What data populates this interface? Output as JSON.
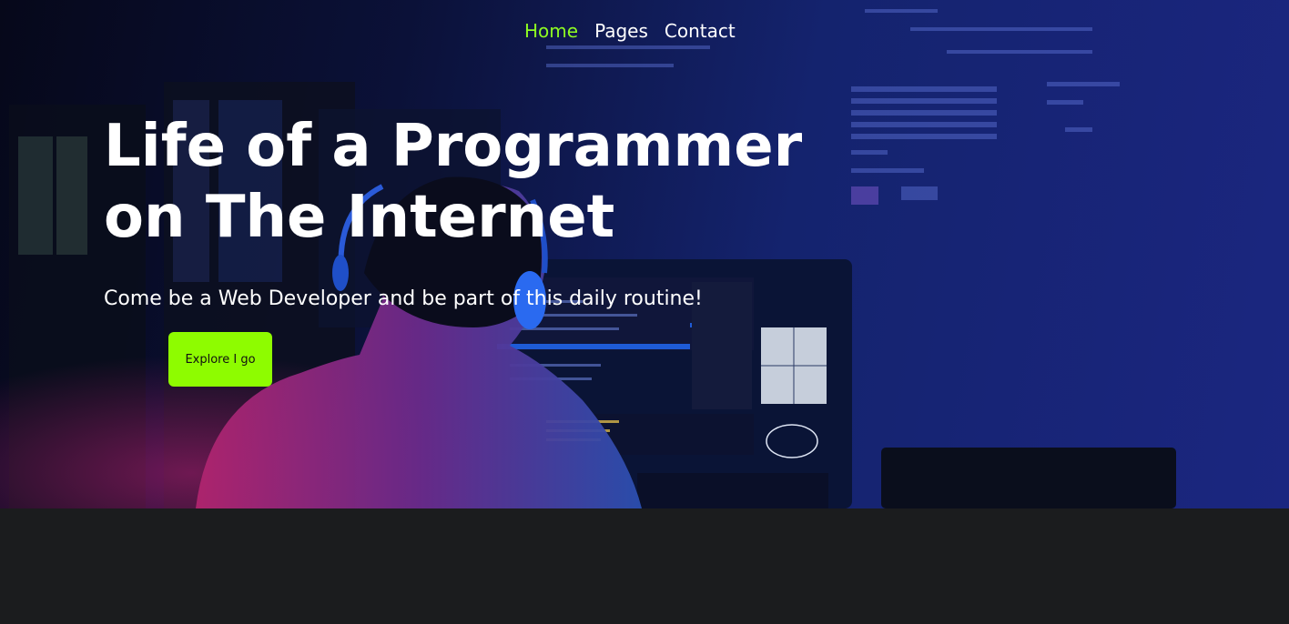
{
  "nav": {
    "items": [
      {
        "label": "Home",
        "active": true
      },
      {
        "label": "Pages",
        "active": false
      },
      {
        "label": "Contact",
        "active": false
      }
    ]
  },
  "hero": {
    "title_line1": "Life of a Programmer",
    "title_line2": "on The Internet",
    "subtitle": "Come be a Web Developer and be part of this daily routine!",
    "cta_label": "Explore I go",
    "background_image": "programmer-at-computer-photo"
  },
  "colors": {
    "accent": "#8efc00",
    "nav_active": "#8efc22",
    "hero_bg": "#14236e",
    "page_bg": "#1b1c1e",
    "text": "#ffffff"
  }
}
